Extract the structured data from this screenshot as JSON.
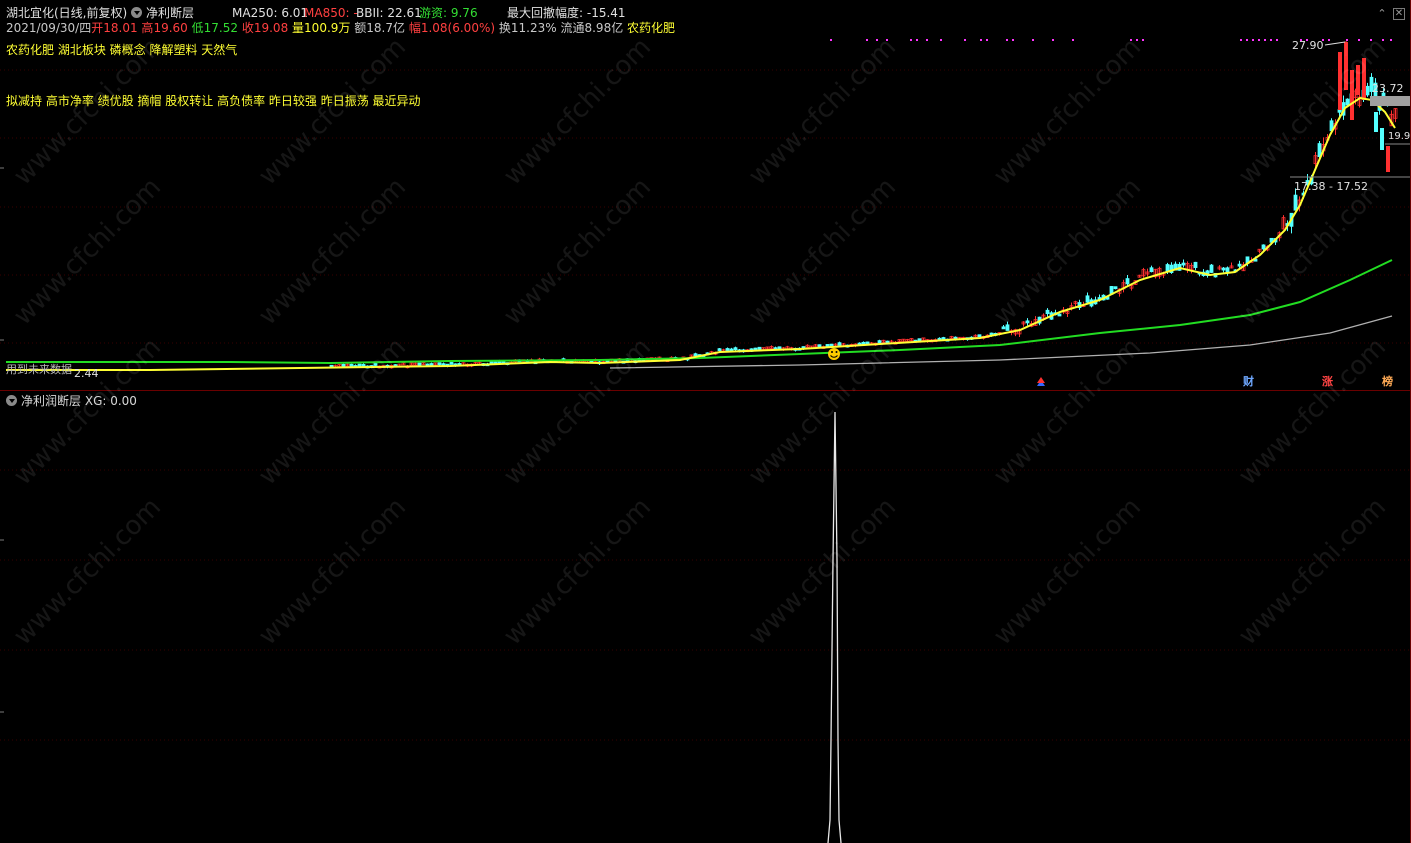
{
  "header": {
    "stock_title": "湖北宜化(日线,前复权)",
    "indicator_name": "净利断层",
    "ma250": "MA250: 6.01",
    "ma850": "MA850: -",
    "bbi": "BBII: 22.61",
    "youzi": "游资: 9.76",
    "max_drawdown": "最大回撤幅度: -15.41"
  },
  "quote": {
    "date": "2021/09/30/四",
    "open_label": "开",
    "open": "18.01",
    "high_label": "高",
    "high": "19.60",
    "low_label": "低",
    "low": "17.52",
    "close_label": "收",
    "close": "19.08",
    "vol_label": "量",
    "vol": "100.9万",
    "amount_label": "额",
    "amount": "18.7亿",
    "change_label": "幅",
    "change": "1.08(6.00%)",
    "turnover_label": "换",
    "turnover": "11.23%",
    "float_label": "流通",
    "float": "8.98亿",
    "industry": "农药化肥"
  },
  "tags": {
    "line1": "农药化肥 湖北板块 磷概念 降解塑料 天然气",
    "line2": "拟减持 高市净率 绩优股 摘帽 股权转让 高负债率 昨日较强 昨日振荡 最近异动"
  },
  "price_labels": {
    "high_mark": "27.90",
    "right_mark1": "23.72",
    "right_mark2": "19.9",
    "range": "17.38 - 17.52",
    "low_left": "2.44",
    "bottom_left": "用到未来数据"
  },
  "markers": {
    "cai": "财",
    "zhang": "涨",
    "bang": "榜"
  },
  "lower_panel": {
    "title": "净利润断层",
    "xg": "XG: 0.00"
  },
  "watermark": "www.cfchi.com",
  "colors": {
    "background": "#000000",
    "grid": "#3a0000",
    "up": "#ff3030",
    "down": "#54ffff",
    "ma_yellow": "#ffff33",
    "ma_green": "#22dd22",
    "ma_gray": "#b0b0b0",
    "accent_magenta": "#ff33ff"
  }
}
